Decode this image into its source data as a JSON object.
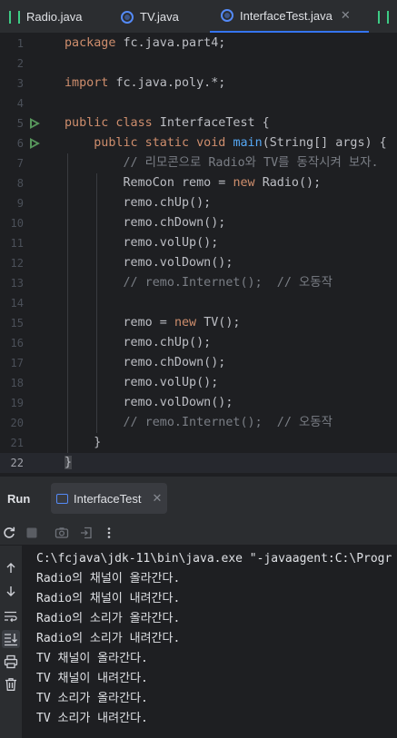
{
  "tabs": [
    {
      "label": "Radio.java",
      "icon": "interface-icon",
      "active": false
    },
    {
      "label": "TV.java",
      "icon": "class-icon",
      "active": false
    },
    {
      "label": "InterfaceTest.java",
      "icon": "class-icon",
      "active": true
    }
  ],
  "editor": {
    "current_line": 22,
    "lines": [
      {
        "num": "1",
        "tokens": [
          [
            "kw",
            "package "
          ],
          [
            "",
            "fc.java.part4;"
          ]
        ]
      },
      {
        "num": "2",
        "tokens": []
      },
      {
        "num": "3",
        "tokens": [
          [
            "kw",
            "import "
          ],
          [
            "",
            "fc.java.poly.*;"
          ]
        ]
      },
      {
        "num": "4",
        "tokens": []
      },
      {
        "num": "5",
        "run": true,
        "tokens": [
          [
            "kw",
            "public class "
          ],
          [
            "",
            "InterfaceTest {"
          ]
        ]
      },
      {
        "num": "6",
        "run": true,
        "tokens": [
          [
            "",
            "    "
          ],
          [
            "kw",
            "public static void "
          ],
          [
            "fn",
            "main"
          ],
          [
            "",
            "(String[] args) {"
          ]
        ]
      },
      {
        "num": "7",
        "tokens": [
          [
            "",
            "        "
          ],
          [
            "cm",
            "// 리모콘으로 Radio와 TV를 동작시켜 보자."
          ]
        ]
      },
      {
        "num": "8",
        "tokens": [
          [
            "",
            "        RemoCon remo = "
          ],
          [
            "kw",
            "new "
          ],
          [
            "",
            "Radio();"
          ]
        ]
      },
      {
        "num": "9",
        "tokens": [
          [
            "",
            "        remo.chUp();"
          ]
        ]
      },
      {
        "num": "10",
        "tokens": [
          [
            "",
            "        remo.chDown();"
          ]
        ]
      },
      {
        "num": "11",
        "tokens": [
          [
            "",
            "        remo.volUp();"
          ]
        ]
      },
      {
        "num": "12",
        "tokens": [
          [
            "",
            "        remo.volDown();"
          ]
        ]
      },
      {
        "num": "13",
        "tokens": [
          [
            "",
            "        "
          ],
          [
            "cm",
            "// remo.Internet();  // 오동작"
          ]
        ]
      },
      {
        "num": "14",
        "tokens": []
      },
      {
        "num": "15",
        "tokens": [
          [
            "",
            "        remo = "
          ],
          [
            "kw",
            "new "
          ],
          [
            "",
            "TV();"
          ]
        ]
      },
      {
        "num": "16",
        "tokens": [
          [
            "",
            "        remo.chUp();"
          ]
        ]
      },
      {
        "num": "17",
        "tokens": [
          [
            "",
            "        remo.chDown();"
          ]
        ]
      },
      {
        "num": "18",
        "tokens": [
          [
            "",
            "        remo.volUp();"
          ]
        ]
      },
      {
        "num": "19",
        "tokens": [
          [
            "",
            "        remo.volDown();"
          ]
        ]
      },
      {
        "num": "20",
        "tokens": [
          [
            "",
            "        "
          ],
          [
            "cm",
            "// remo.Internet();  // 오동작"
          ]
        ]
      },
      {
        "num": "21",
        "tokens": [
          [
            "",
            "    }"
          ]
        ]
      },
      {
        "num": "22",
        "tokens": [
          [
            "hl",
            "}"
          ]
        ]
      }
    ]
  },
  "run": {
    "title": "Run",
    "tab_label": "InterfaceTest",
    "output": [
      "C:\\fcjava\\jdk-11\\bin\\java.exe \"-javaagent:C:\\Progr",
      "Radio의 채널이 올라간다.",
      "Radio의 채널이 내려간다.",
      "Radio의 소리가 올라간다.",
      "Radio의 소리가 내려간다.",
      "TV 채널이 올라간다.",
      "TV 채널이 내려간다.",
      "TV 소리가 올라간다.",
      "TV 소리가 내려간다."
    ]
  },
  "colors": {
    "keyword": "#cf8e6d",
    "function": "#56a8f5",
    "comment": "#7a7e85",
    "text": "#bcbec4",
    "run_marker": "#57965c",
    "accent": "#3574f0"
  }
}
